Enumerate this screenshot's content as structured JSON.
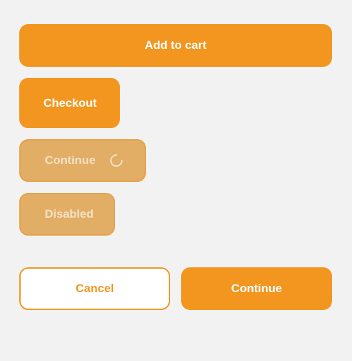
{
  "buttons": {
    "add_to_cart": "Add to cart",
    "checkout": "Checkout",
    "continue_loading": "Continue",
    "disabled": "Disabled",
    "cancel": "Cancel",
    "continue": "Continue"
  },
  "states": {
    "continue_loading": "loading",
    "disabled": "disabled"
  },
  "icons": {
    "spinner": "loading-spinner-icon"
  },
  "colors": {
    "primary": "#f29620",
    "primary_muted": "#e2ad65",
    "muted_text": "#f2e1c6",
    "background": "#f2f2f2",
    "outline_text": "#f29620"
  }
}
